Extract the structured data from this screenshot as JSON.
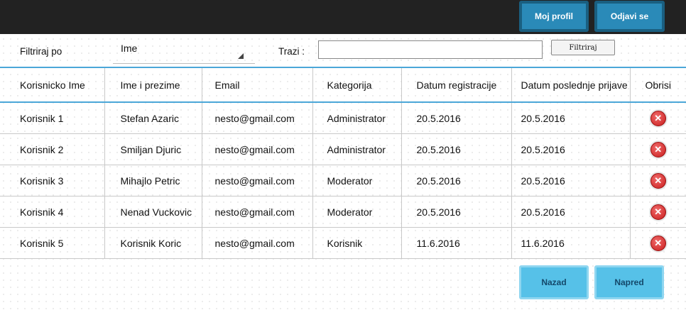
{
  "header": {
    "profile_label": "Moj profil",
    "logout_label": "Odjavi se"
  },
  "filter": {
    "label": "Filtriraj po",
    "select_value": "Ime",
    "search_label": "Trazi :",
    "search_value": "",
    "button_label": "Filtriraj"
  },
  "table": {
    "columns": [
      "Korisnicko Ime",
      "Ime i prezime",
      "Email",
      "Kategorija",
      "Datum registracije",
      "Datum poslednje prijave",
      "Obrisi"
    ],
    "rows": [
      [
        "Korisnik 1",
        "Stefan Azaric",
        "nesto@gmail.com",
        "Administrator",
        "20.5.2016",
        "20.5.2016"
      ],
      [
        "Korisnik 2",
        "Smiljan Djuric",
        "nesto@gmail.com",
        "Administrator",
        "20.5.2016",
        "20.5.2016"
      ],
      [
        "Korisnik 3",
        "Mihajlo Petric",
        "nesto@gmail.com",
        "Moderator",
        "20.5.2016",
        "20.5.2016"
      ],
      [
        "Korisnik 4",
        "Nenad Vuckovic",
        "nesto@gmail.com",
        "Moderator",
        "20.5.2016",
        "20.5.2016"
      ],
      [
        "Korisnik 5",
        "Korisnik Koric",
        "nesto@gmail.com",
        "Korisnik",
        "11.6.2016",
        "11.6.2016"
      ]
    ],
    "delete_icon": "delete-circle-x-icon"
  },
  "pagination": {
    "back_label": "Nazad",
    "next_label": "Napred"
  },
  "colors": {
    "accent": "#4ba7d8",
    "topbar": "#222222",
    "button": "#2a8ab8",
    "nav_button": "#56c1e8",
    "delete": "#c91d1d"
  }
}
